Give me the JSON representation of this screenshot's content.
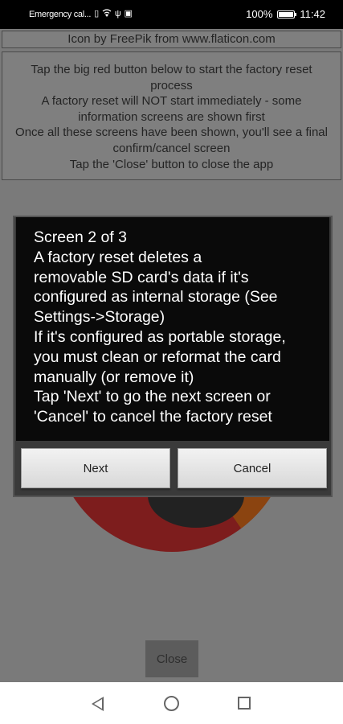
{
  "status_bar": {
    "carrier_text": "Emergency cal...",
    "battery_percent": "100%",
    "battery_level": 1.0,
    "time": "11:42",
    "icons": [
      "sim-icon",
      "wifi-icon",
      "usb-icon",
      "screenshot-icon",
      "battery-icon"
    ]
  },
  "app": {
    "credit": "Icon by FreePik from www.flaticon.com",
    "info_lines": [
      "Tap the big red button below to start the factory reset",
      "process",
      "A factory reset will NOT start immediately - some",
      "information screens are shown first",
      "Once all these screens have been shown, you'll see a final",
      "confirm/cancel screen",
      "Tap the 'Close' button to close the app"
    ],
    "close_label": "Close"
  },
  "dialog": {
    "lines": [
      "Screen 2 of 3",
      "A factory reset deletes a",
      "removable SD card's data if it's",
      "configured as internal storage (See",
      "Settings->Storage)",
      "If it's configured as portable storage,",
      "you must clean or reformat the card",
      "manually (or remove it)",
      "Tap 'Next' to go the next screen or",
      "'Cancel' to cancel the factory reset"
    ],
    "next_label": "Next",
    "cancel_label": "Cancel"
  },
  "nav_bar": {
    "icons": [
      "back-icon",
      "home-icon",
      "recents-icon"
    ]
  }
}
